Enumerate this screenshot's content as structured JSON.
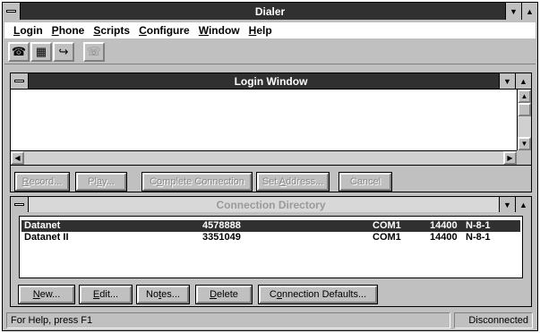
{
  "app": {
    "title": "Dialer"
  },
  "menu": {
    "items": [
      {
        "u": "L",
        "rest": "ogin"
      },
      {
        "u": "P",
        "rest": "hone"
      },
      {
        "u": "S",
        "rest": "cripts"
      },
      {
        "u": "C",
        "rest": "onfigure"
      },
      {
        "u": "W",
        "rest": "indow"
      },
      {
        "u": "H",
        "rest": "elp"
      }
    ]
  },
  "login_window": {
    "title": "Login Window",
    "buttons": {
      "record": {
        "pre": "",
        "u": "R",
        "post": "ecord..."
      },
      "play": {
        "pre": "Pl",
        "u": "a",
        "post": "y..."
      },
      "complete": {
        "pre": "C",
        "u": "o",
        "post": "mplete Connection"
      },
      "set_address": {
        "pre": "Set ",
        "u": "A",
        "post": "ddress..."
      },
      "cancel": {
        "pre": "Cancel",
        "u": "",
        "post": ""
      }
    }
  },
  "directory": {
    "title": "Connection Directory",
    "rows": [
      {
        "name": "Datanet",
        "number": "4578888",
        "port": "COM1",
        "speed": "14400",
        "settings": "N-8-1",
        "selected": true
      },
      {
        "name": "Datanet II",
        "number": "3351049",
        "port": "COM1",
        "speed": "14400",
        "settings": "N-8-1",
        "selected": false
      }
    ],
    "buttons": {
      "new": {
        "pre": "",
        "u": "N",
        "post": "ew..."
      },
      "edit": {
        "pre": "",
        "u": "E",
        "post": "dit..."
      },
      "notes": {
        "pre": "No",
        "u": "t",
        "post": "es..."
      },
      "delete": {
        "pre": "",
        "u": "D",
        "post": "elete"
      },
      "defaults": {
        "pre": "C",
        "u": "o",
        "post": "nnection Defaults..."
      }
    }
  },
  "status": {
    "help": "For Help, press F1",
    "connection": "Disconnected"
  }
}
